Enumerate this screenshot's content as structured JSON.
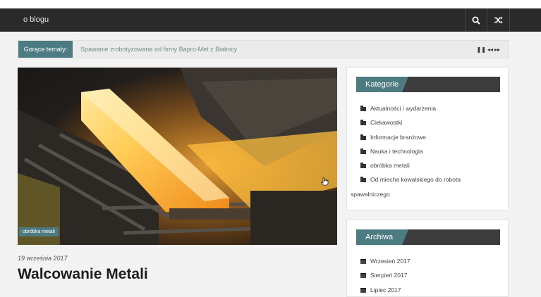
{
  "nav": {
    "link_label": "o blogu",
    "search_icon": "search-icon",
    "shuffle_icon": "shuffle-icon"
  },
  "ticker": {
    "label": "Gorące tematy:",
    "headline": "Spawanie zrobotyzowane od firmy Bapro-Met z Białnicy",
    "controls": {
      "pause": "❚❚",
      "prev": "◂◂",
      "next": "▸▸"
    }
  },
  "post": {
    "category_tag": "obróbka metali",
    "date": "19 września 2017",
    "title": "Walcowanie Metali",
    "image": "hot-steel-rolling-mill-image"
  },
  "sidebar": {
    "categories": {
      "title": "Kategorie",
      "items": [
        "Aktualności i wydarzenia",
        "Ciekawostki",
        "Informacje branżowe",
        "Nauka i technologia",
        "obróbka metali"
      ],
      "last_item_line1": "Od miecha kowalskiego do robota",
      "last_item_line2": "spawalniczego"
    },
    "archive": {
      "title": "Archiwa",
      "items": [
        "Wrzesień 2017",
        "Sierpień 2017",
        "Lipiec 2017"
      ]
    }
  },
  "colors": {
    "accent": "#4c7b82",
    "navbar": "#2a2a2a",
    "widget_header": "#3c3c3c"
  }
}
